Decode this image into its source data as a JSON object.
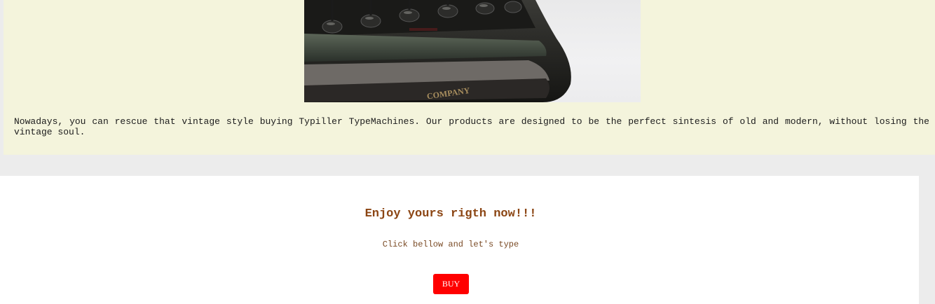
{
  "about": {
    "image_alt": "vintage typewriter close-up",
    "description": "Nowadays, you can rescue that vintage style buying Typiller TypeMachines. Our products are designed to be the perfect sintesis of old and modern, without losing the vintage soul."
  },
  "cta": {
    "heading": "Enjoy yours rigth now!!!",
    "subtitle": "Click bellow and let's type",
    "button_label": "BUY"
  },
  "colors": {
    "about_background": "#f4f4dc",
    "page_background": "#ececec",
    "cta_background": "#ffffff",
    "heading_color": "#8b4513",
    "button_background": "#ff0000",
    "button_text": "#ffffff"
  }
}
